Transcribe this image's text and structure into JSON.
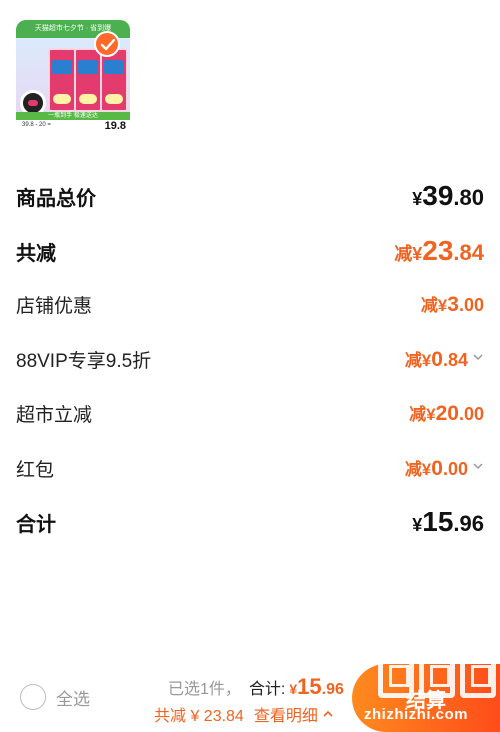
{
  "product": {
    "banner": "天猫超市七夕节 · 省到爆",
    "green_bar": "一瓶到手 极速送达",
    "nums": "39.8 - 20 =",
    "price": "19.8"
  },
  "rows": [
    {
      "label": "商品总价",
      "prefix": "¥",
      "int": "39",
      "dec": ".80"
    },
    {
      "label": "共减",
      "prefix": "减¥",
      "int": "23",
      "dec": ".84"
    },
    {
      "label": "店铺优惠",
      "prefix": "减¥",
      "int": "3",
      "dec": ".00"
    },
    {
      "label": "88VIP专享9.5折",
      "prefix": "减¥",
      "int": "0",
      "dec": ".84"
    },
    {
      "label": "超市立减",
      "prefix": "减¥",
      "int": "20",
      "dec": ".00"
    },
    {
      "label": "红包",
      "prefix": "减¥",
      "int": "0",
      "dec": ".00"
    },
    {
      "label": "合计",
      "prefix": "¥",
      "int": "15",
      "dec": ".96"
    }
  ],
  "bottom": {
    "select_all": "全选",
    "selected": "已选1件，",
    "total_label": "合计:",
    "total_prefix": "¥",
    "total_int": "15",
    "total_dec": ".96",
    "reduced": "共减 ¥ 23.84",
    "view_detail": "查看明细",
    "checkout": "结算",
    "watermark": "zhizhizhi.com"
  },
  "colors": {
    "accent": "#f06422",
    "text": "#111111"
  }
}
